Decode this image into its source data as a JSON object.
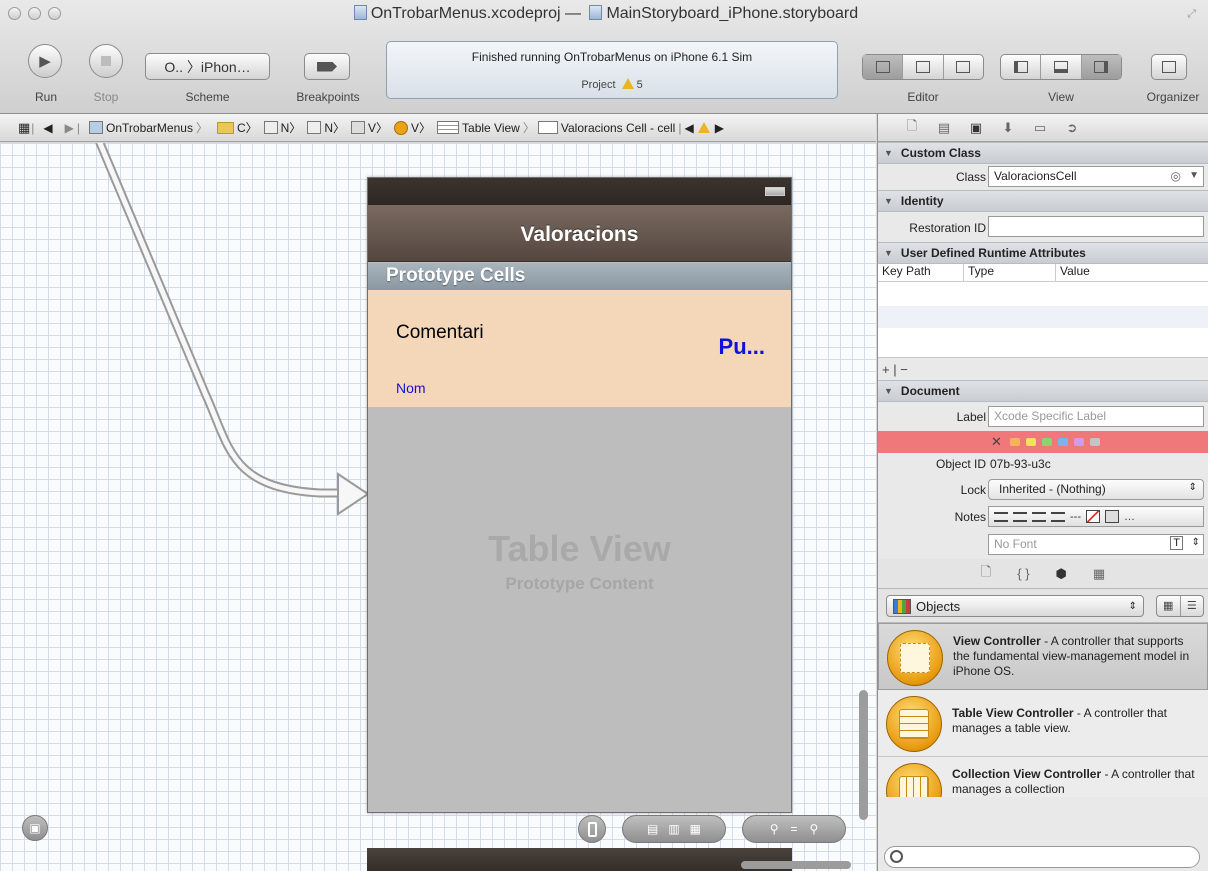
{
  "window": {
    "title_project": "OnTrobarMenus.xcodeproj",
    "title_dash": "—",
    "title_file": "MainStoryboard_iPhone.storyboard"
  },
  "toolbar": {
    "run_label": "Run",
    "stop_label": "Stop",
    "scheme_value": "O.. 〉iPhon…",
    "scheme_label": "Scheme",
    "breakpoints_label": "Breakpoints",
    "status_text": "Finished running OnTrobarMenus on iPhone 6.1 Sim",
    "project_label": "Project",
    "warning_count": "5",
    "editor_label": "Editor",
    "view_label": "View",
    "organizer_label": "Organizer"
  },
  "jumpbar": {
    "items": [
      "OnTrobarMenus",
      "C〉",
      "N〉",
      "N〉",
      "V〉",
      "V〉",
      "Table View",
      "Valoracions Cell - cell"
    ]
  },
  "storyboard": {
    "nav_title": "Valoracions",
    "section_header": "Prototype Cells",
    "cell_comentari": "Comentari",
    "cell_puntuacio": "Pu...",
    "cell_nom": "Nom",
    "placeholder_title": "Table View",
    "placeholder_subtitle": "Prototype Content"
  },
  "inspector": {
    "custom_class_header": "Custom Class",
    "class_label": "Class",
    "class_value": "ValoracionsCell",
    "identity_header": "Identity",
    "restoration_id_label": "Restoration ID",
    "restoration_id_value": "",
    "udra_header": "User Defined Runtime Attributes",
    "col_keypath": "Key Path",
    "col_type": "Type",
    "col_value": "Value",
    "plus_minus": "+ | −",
    "document_header": "Document",
    "label_label": "Label",
    "label_placeholder": "Xcode Specific Label",
    "object_id_label": "Object ID",
    "object_id_value": "07b-93-u3c",
    "lock_label": "Lock",
    "lock_value": "Inherited - (Nothing)",
    "notes_label": "Notes",
    "font_placeholder": "No Font",
    "label_colors": [
      "#f0787a",
      "#f5b45c",
      "#f2e25c",
      "#8fd36f",
      "#7ab4ef",
      "#d39ae6",
      "#c4c4c4"
    ]
  },
  "library": {
    "selector_value": "Objects",
    "items": [
      {
        "name": "View Controller",
        "desc": " - A controller that supports the fundamental view-management model in iPhone OS."
      },
      {
        "name": "Table View Controller",
        "desc": " - A controller that manages a table view."
      },
      {
        "name": "Collection View Controller",
        "desc": " - A controller that manages a collection"
      }
    ]
  }
}
